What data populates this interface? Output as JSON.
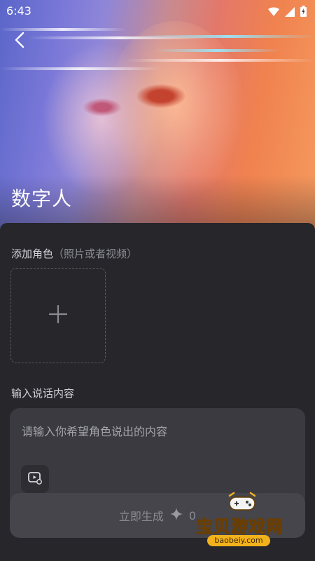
{
  "status_bar": {
    "time": "6:43"
  },
  "header": {
    "title": "数字人"
  },
  "add_role": {
    "label": "添加角色",
    "hint": "（照片或者视频）"
  },
  "speech": {
    "label": "输入说话内容",
    "placeholder": "请输入你希望角色说出的内容"
  },
  "generate": {
    "label": "立即生成",
    "cost": "0"
  },
  "watermark": {
    "text": "宝贝游戏网",
    "url": "baobeiy.com"
  },
  "icons": {
    "back": "chevron-left-icon",
    "add": "plus-icon",
    "media": "video-upload-icon",
    "cost": "sparkle-icon",
    "wifi": "wifi-icon",
    "signal": "signal-icon",
    "battery": "battery-icon"
  },
  "colors": {
    "panel": "#26262b",
    "card": "#3a3a40",
    "button": "#45454b",
    "watermark": "#f2b21b"
  }
}
